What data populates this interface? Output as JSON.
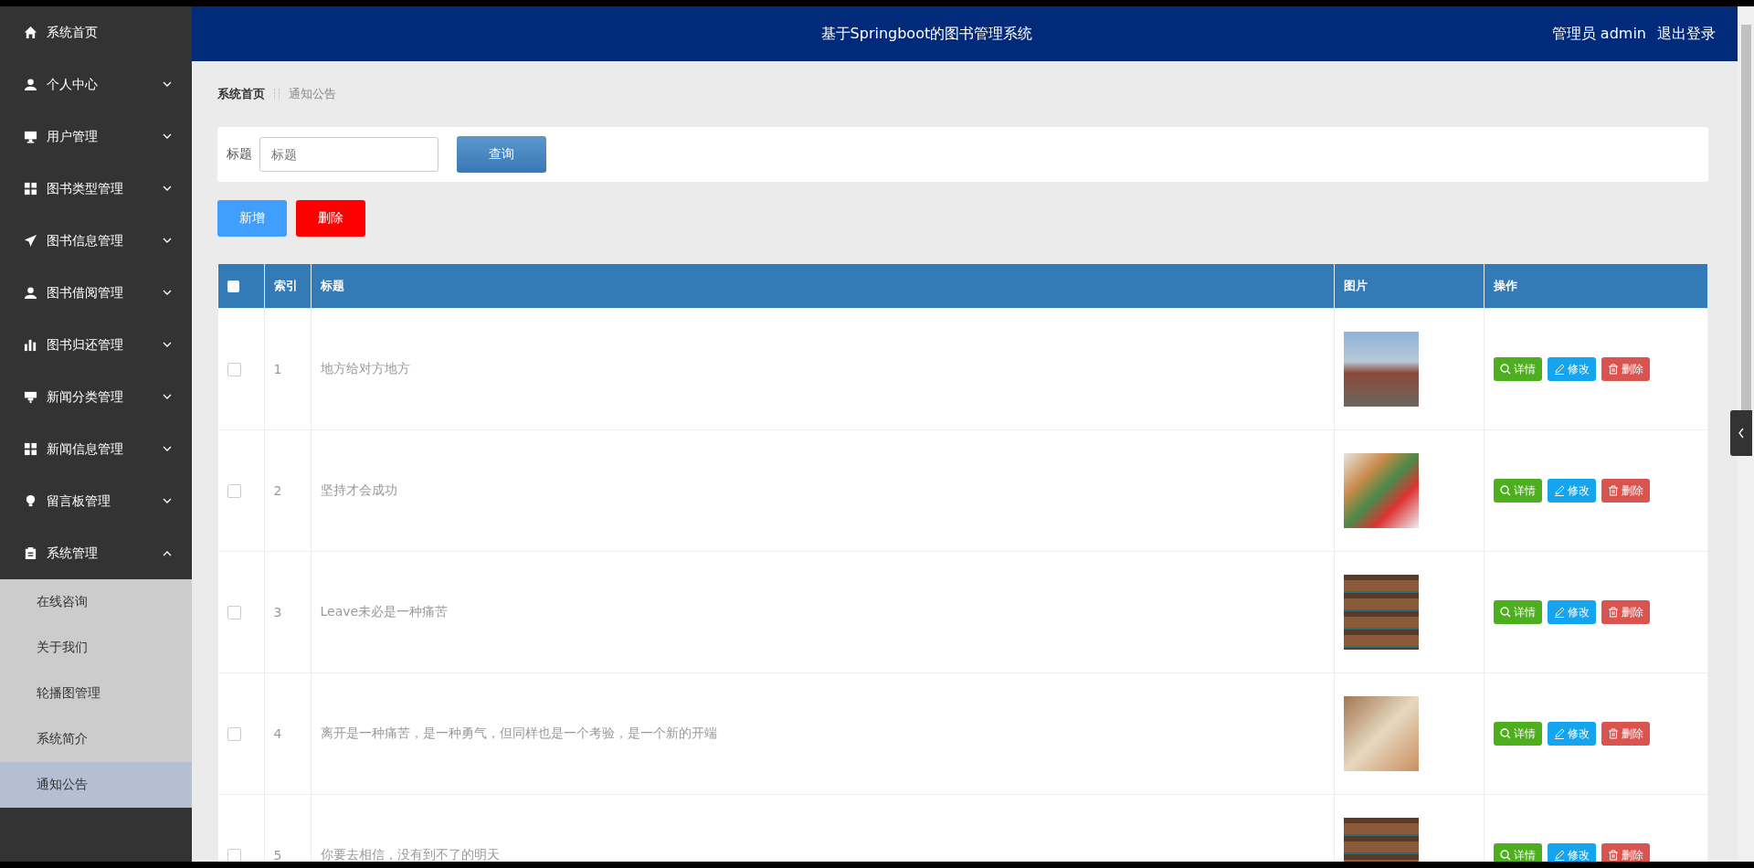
{
  "header": {
    "title": "基于Springboot的图书管理系统",
    "user": "管理员 admin",
    "logout": "退出登录"
  },
  "sidebar": {
    "items": [
      {
        "label": "系统首页"
      },
      {
        "label": "个人中心",
        "expanded": false
      },
      {
        "label": "用户管理",
        "expanded": false
      },
      {
        "label": "图书类型管理",
        "expanded": false
      },
      {
        "label": "图书信息管理",
        "expanded": false
      },
      {
        "label": "图书借阅管理",
        "expanded": false
      },
      {
        "label": "图书归还管理",
        "expanded": false
      },
      {
        "label": "新闻分类管理",
        "expanded": false
      },
      {
        "label": "新闻信息管理",
        "expanded": false
      },
      {
        "label": "留言板管理",
        "expanded": false
      },
      {
        "label": "系统管理",
        "expanded": true,
        "children": [
          {
            "label": "在线咨询",
            "selected": false
          },
          {
            "label": "关于我们",
            "selected": false
          },
          {
            "label": "轮播图管理",
            "selected": false
          },
          {
            "label": "系统简介",
            "selected": false
          },
          {
            "label": "通知公告",
            "selected": true
          }
        ]
      }
    ]
  },
  "breadcrumb": [
    {
      "label": "系统首页"
    },
    {
      "label": "通知公告"
    }
  ],
  "search": {
    "label": "标题",
    "placeholder": "标题",
    "button": "查询"
  },
  "actions": [
    {
      "label": "新增",
      "kind": "add"
    },
    {
      "label": "删除",
      "kind": "delete"
    }
  ],
  "table": {
    "header_checked": false,
    "columns": [
      "索引",
      "标题",
      "图片",
      "操作"
    ],
    "rows": [
      {
        "checked": false,
        "index": "1",
        "title": "地方给对方地方",
        "buttons": [
          {
            "label": "详情",
            "kind": "detail"
          },
          {
            "label": "修改",
            "kind": "edit"
          },
          {
            "label": "删除",
            "kind": "delete"
          }
        ]
      },
      {
        "checked": false,
        "index": "2",
        "title": "坚持才会成功",
        "buttons": [
          {
            "label": "详情",
            "kind": "detail"
          },
          {
            "label": "修改",
            "kind": "edit"
          },
          {
            "label": "删除",
            "kind": "delete"
          }
        ]
      },
      {
        "checked": false,
        "index": "3",
        "title": "Leave未必是一种痛苦",
        "buttons": [
          {
            "label": "详情",
            "kind": "detail"
          },
          {
            "label": "修改",
            "kind": "edit"
          },
          {
            "label": "删除",
            "kind": "delete"
          }
        ]
      },
      {
        "checked": false,
        "index": "4",
        "title": "离开是一种痛苦，是一种勇气，但同样也是一个考验，是一个新的开端",
        "buttons": [
          {
            "label": "详情",
            "kind": "detail"
          },
          {
            "label": "修改",
            "kind": "edit"
          },
          {
            "label": "删除",
            "kind": "delete"
          }
        ]
      },
      {
        "checked": false,
        "index": "5",
        "title": "你要去相信，没有到不了的明天",
        "buttons": [
          {
            "label": "详情",
            "kind": "detail"
          },
          {
            "label": "修改",
            "kind": "edit"
          },
          {
            "label": "删除",
            "kind": "delete"
          }
        ]
      }
    ]
  }
}
